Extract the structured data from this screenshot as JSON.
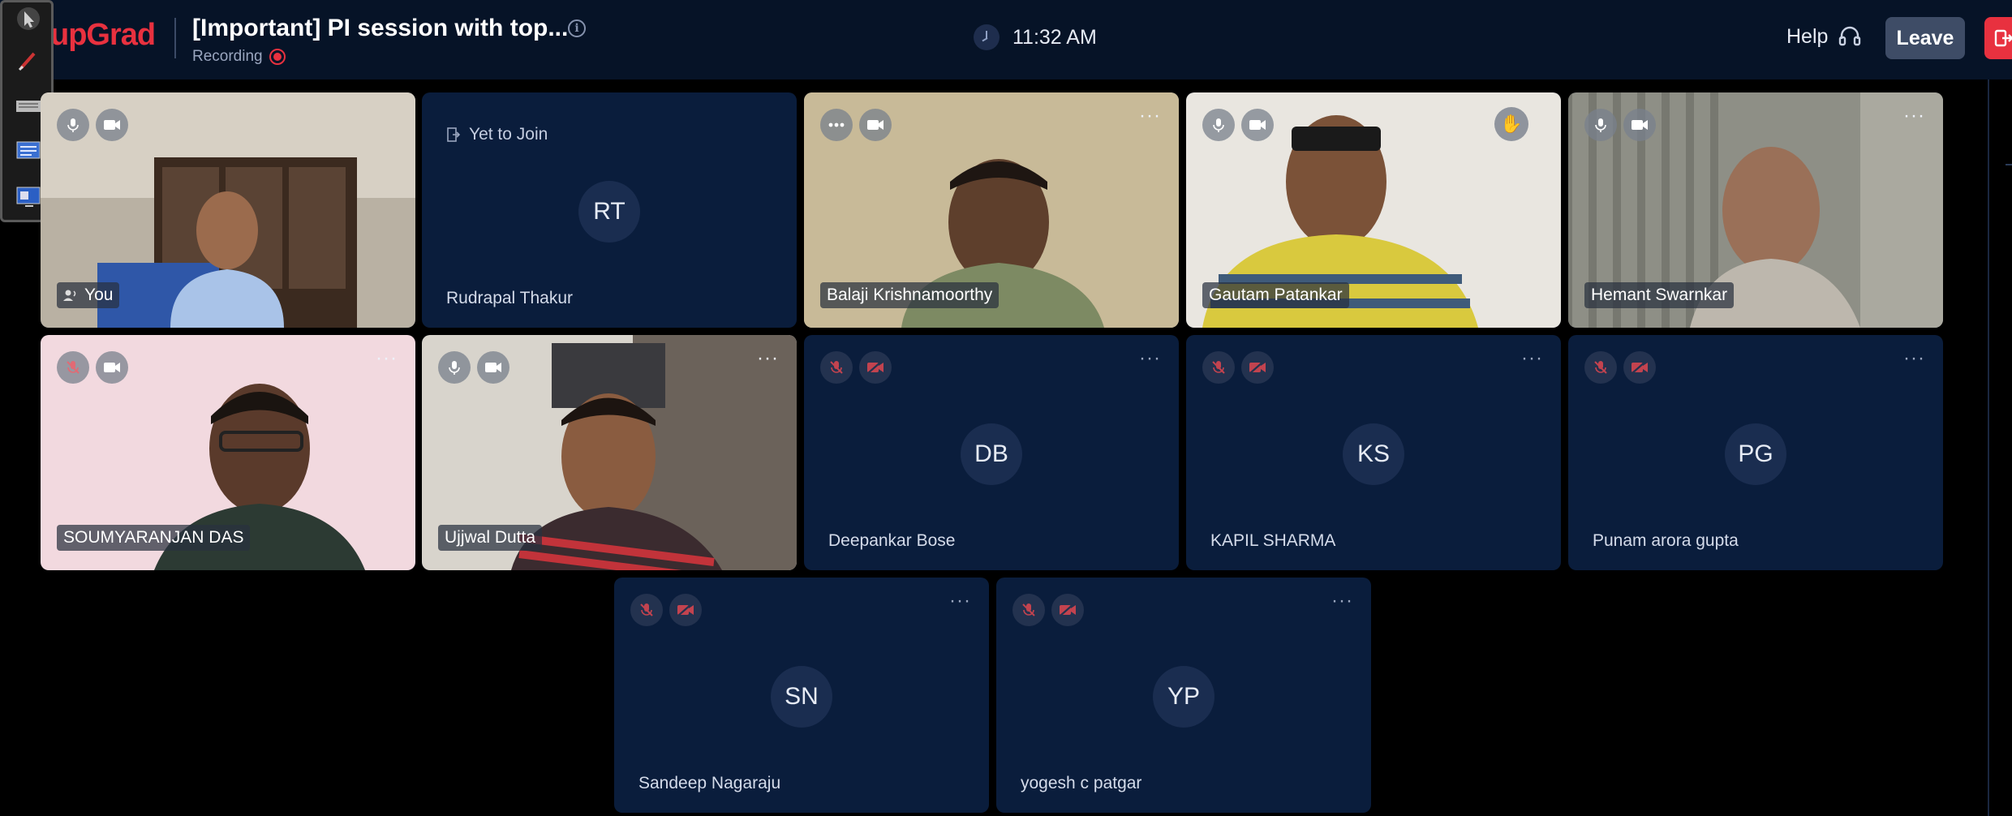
{
  "header": {
    "brand": "upGrad",
    "meeting_title": "[Important] PI session with top...",
    "recording_label": "Recording",
    "time": "11:32 AM",
    "help_label": "Help",
    "leave_label": "Leave"
  },
  "colors": {
    "brand_red": "#e8313f",
    "header_bg": "#061327",
    "tile_bg": "#0a1d3c",
    "leave_bg": "#3e4c66"
  },
  "toolbar": {
    "tools": [
      "cursor-icon",
      "pen-icon",
      "keyboard-icon",
      "whiteboard-icon",
      "screen-icon"
    ]
  },
  "participants": [
    {
      "name": "You",
      "video": true,
      "mic": "on",
      "cam": "on"
    },
    {
      "name": "Rudrapal Thakur",
      "initials": "RT",
      "video": false,
      "status": "Yet to Join"
    },
    {
      "name": "Balaji Krishnamoorthy",
      "video": true,
      "mic": "more",
      "cam": "on"
    },
    {
      "name": "Gautam Patankar",
      "video": true,
      "mic": "on",
      "cam": "on",
      "hand_raised": true
    },
    {
      "name": "Hemant Swarnkar",
      "video": true,
      "mic": "on",
      "cam": "on"
    },
    {
      "name": "SOUMYARANJAN DAS",
      "video": true,
      "mic": "muted",
      "cam": "on"
    },
    {
      "name": "Ujjwal Dutta",
      "video": true,
      "mic": "on",
      "cam": "on"
    },
    {
      "name": "Deepankar Bose",
      "initials": "DB",
      "video": false,
      "mic": "muted",
      "cam": "off"
    },
    {
      "name": "KAPIL SHARMA",
      "initials": "KS",
      "video": false,
      "mic": "muted",
      "cam": "off"
    },
    {
      "name": "Punam arora gupta",
      "initials": "PG",
      "video": false,
      "mic": "muted",
      "cam": "off"
    },
    {
      "name": "Sandeep Nagaraju",
      "initials": "SN",
      "video": false,
      "mic": "muted",
      "cam": "off"
    },
    {
      "name": "yogesh c patgar",
      "initials": "YP",
      "video": false,
      "mic": "muted",
      "cam": "off"
    }
  ]
}
